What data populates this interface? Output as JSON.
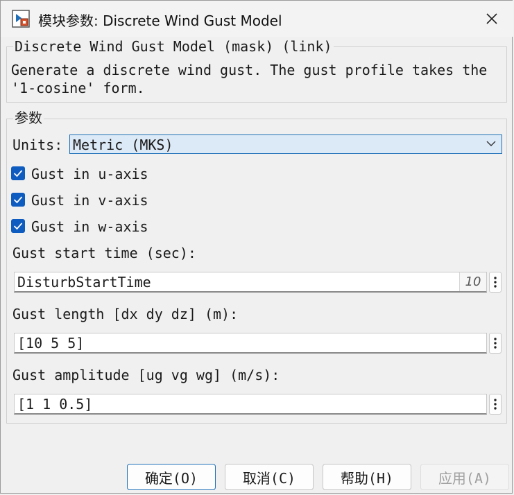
{
  "window": {
    "title": "模块参数: Discrete Wind Gust Model"
  },
  "block": {
    "header": "Discrete Wind Gust Model (mask) (link)",
    "description_line1": "Generate a discrete wind gust. The gust profile takes the",
    "description_line2": "'1-cosine' form."
  },
  "parameters": {
    "group_label": "参数",
    "units_label": "Units:",
    "units_value": "Metric (MKS)",
    "checkboxes": [
      {
        "label": "Gust in u-axis",
        "checked": true
      },
      {
        "label": "Gust in v-axis",
        "checked": true
      },
      {
        "label": "Gust in w-axis",
        "checked": true
      }
    ],
    "start_time_label": "Gust start time (sec):",
    "start_time_value": "DisturbStartTime",
    "start_time_hint": "10",
    "length_label": "Gust length [dx dy dz] (m):",
    "length_value": "[10 5 5]",
    "amplitude_label": "Gust amplitude [ug vg wg] (m/s):",
    "amplitude_value": "[1 1 0.5]"
  },
  "buttons": {
    "ok": "确定(O)",
    "cancel": "取消(C)",
    "help": "帮助(H)",
    "apply": "应用(A)"
  },
  "colors": {
    "accent": "#0f5cc0",
    "select_bg": "#dce9f7"
  }
}
